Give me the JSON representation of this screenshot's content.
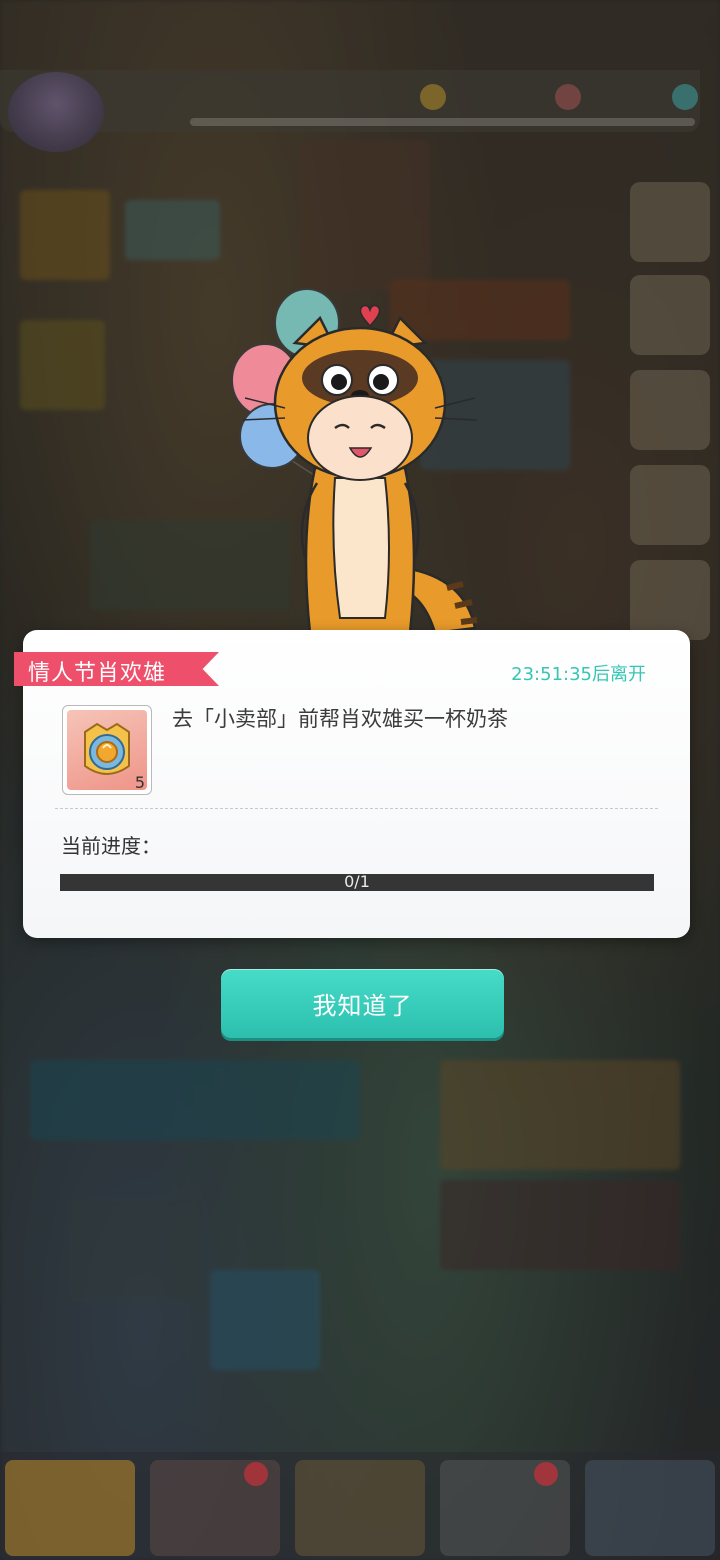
{
  "dialog": {
    "event_title": "情人节肖欢雄",
    "timer": "23:51:35后离开",
    "task_text": "去「小卖部」前帮肖欢雄买一杯奶茶",
    "reward": {
      "icon": "mooncake-token-icon",
      "count": "5"
    },
    "progress_label": "当前进度：",
    "progress": {
      "current": 0,
      "total": 1,
      "text": "0/1"
    }
  },
  "confirm_button": {
    "label": "我知道了"
  },
  "colors": {
    "accent": "#35c6b4",
    "ribbon": "#ee4f6b",
    "button": "#2cbfae"
  }
}
